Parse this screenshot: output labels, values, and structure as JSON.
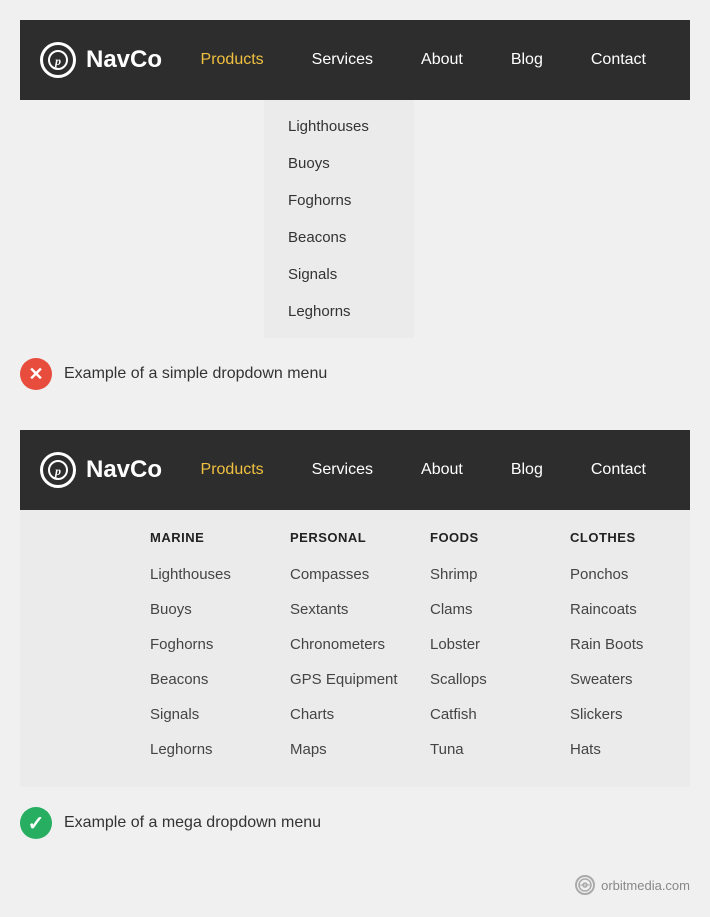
{
  "section1": {
    "navbar": {
      "logo_text": "NavCo",
      "nav_items": [
        {
          "label": "Products",
          "active": true
        },
        {
          "label": "Services",
          "active": false
        },
        {
          "label": "About",
          "active": false
        },
        {
          "label": "Blog",
          "active": false
        },
        {
          "label": "Contact",
          "active": false
        }
      ]
    },
    "simple_dropdown": {
      "items": [
        "Lighthouses",
        "Buoys",
        "Foghorns",
        "Beacons",
        "Signals",
        "Leghorns"
      ]
    },
    "example_label": "Example of a simple dropdown menu"
  },
  "section2": {
    "navbar": {
      "logo_text": "NavCo",
      "nav_items": [
        {
          "label": "Products",
          "active": true
        },
        {
          "label": "Services",
          "active": false
        },
        {
          "label": "About",
          "active": false
        },
        {
          "label": "Blog",
          "active": false
        },
        {
          "label": "Contact",
          "active": false
        }
      ]
    },
    "mega_dropdown": {
      "columns": [
        {
          "header": "MARINE",
          "items": [
            "Lighthouses",
            "Buoys",
            "Foghorns",
            "Beacons",
            "Signals",
            "Leghorns"
          ]
        },
        {
          "header": "PERSONAL",
          "items": [
            "Compasses",
            "Sextants",
            "Chronometers",
            "GPS Equipment",
            "Charts",
            "Maps"
          ]
        },
        {
          "header": "FOODS",
          "items": [
            "Shrimp",
            "Clams",
            "Lobster",
            "Scallops",
            "Catfish",
            "Tuna"
          ]
        },
        {
          "header": "CLOTHES",
          "items": [
            "Ponchos",
            "Raincoats",
            "Rain Boots",
            "Sweaters",
            "Slickers",
            "Hats"
          ]
        }
      ]
    },
    "example_label": "Example of a mega dropdown menu"
  },
  "footer": {
    "watermark": "orbitmedia.com"
  }
}
